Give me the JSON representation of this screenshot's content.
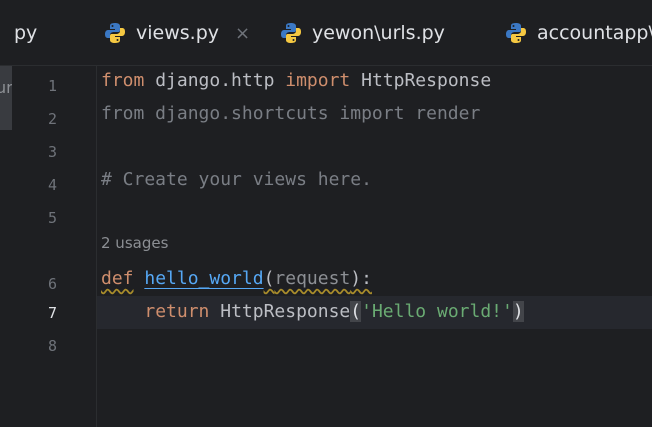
{
  "tabs": [
    {
      "label": "py",
      "icon": "python-icon",
      "active": false,
      "partial": true
    },
    {
      "label": "views.py",
      "icon": "python-icon",
      "active": true
    },
    {
      "label": "yewon\\urls.py",
      "icon": "python-icon",
      "active": false
    },
    {
      "label": "accountapp\\",
      "icon": "python-icon",
      "active": false,
      "partial": true
    }
  ],
  "close_glyph": "×",
  "side_text": "ur",
  "line_numbers": [
    "1",
    "2",
    "3",
    "4",
    "5",
    "6",
    "7",
    "8"
  ],
  "usages_hint": "2 usages",
  "code": {
    "l1": {
      "kw1": "from",
      "mod": " django.http ",
      "kw2": "import",
      "name": " HttpResponse"
    },
    "l2": {
      "text": "from django.shortcuts import render"
    },
    "l4": {
      "text": "# Create your views here."
    },
    "l6": {
      "kw": "def",
      "sp": " ",
      "fn": "hello_world",
      "open": "(",
      "param": "request",
      "close": "):"
    },
    "l7": {
      "indent": "    ",
      "kw": "return",
      "name": " HttpResponse",
      "open": "(",
      "str": "'Hello world!'",
      "close": ")"
    }
  },
  "colors": {
    "background": "#1e1f22",
    "keyword": "#cf8e6d",
    "function": "#56a8f5",
    "string": "#6aab73",
    "comment": "#7a7e85"
  }
}
